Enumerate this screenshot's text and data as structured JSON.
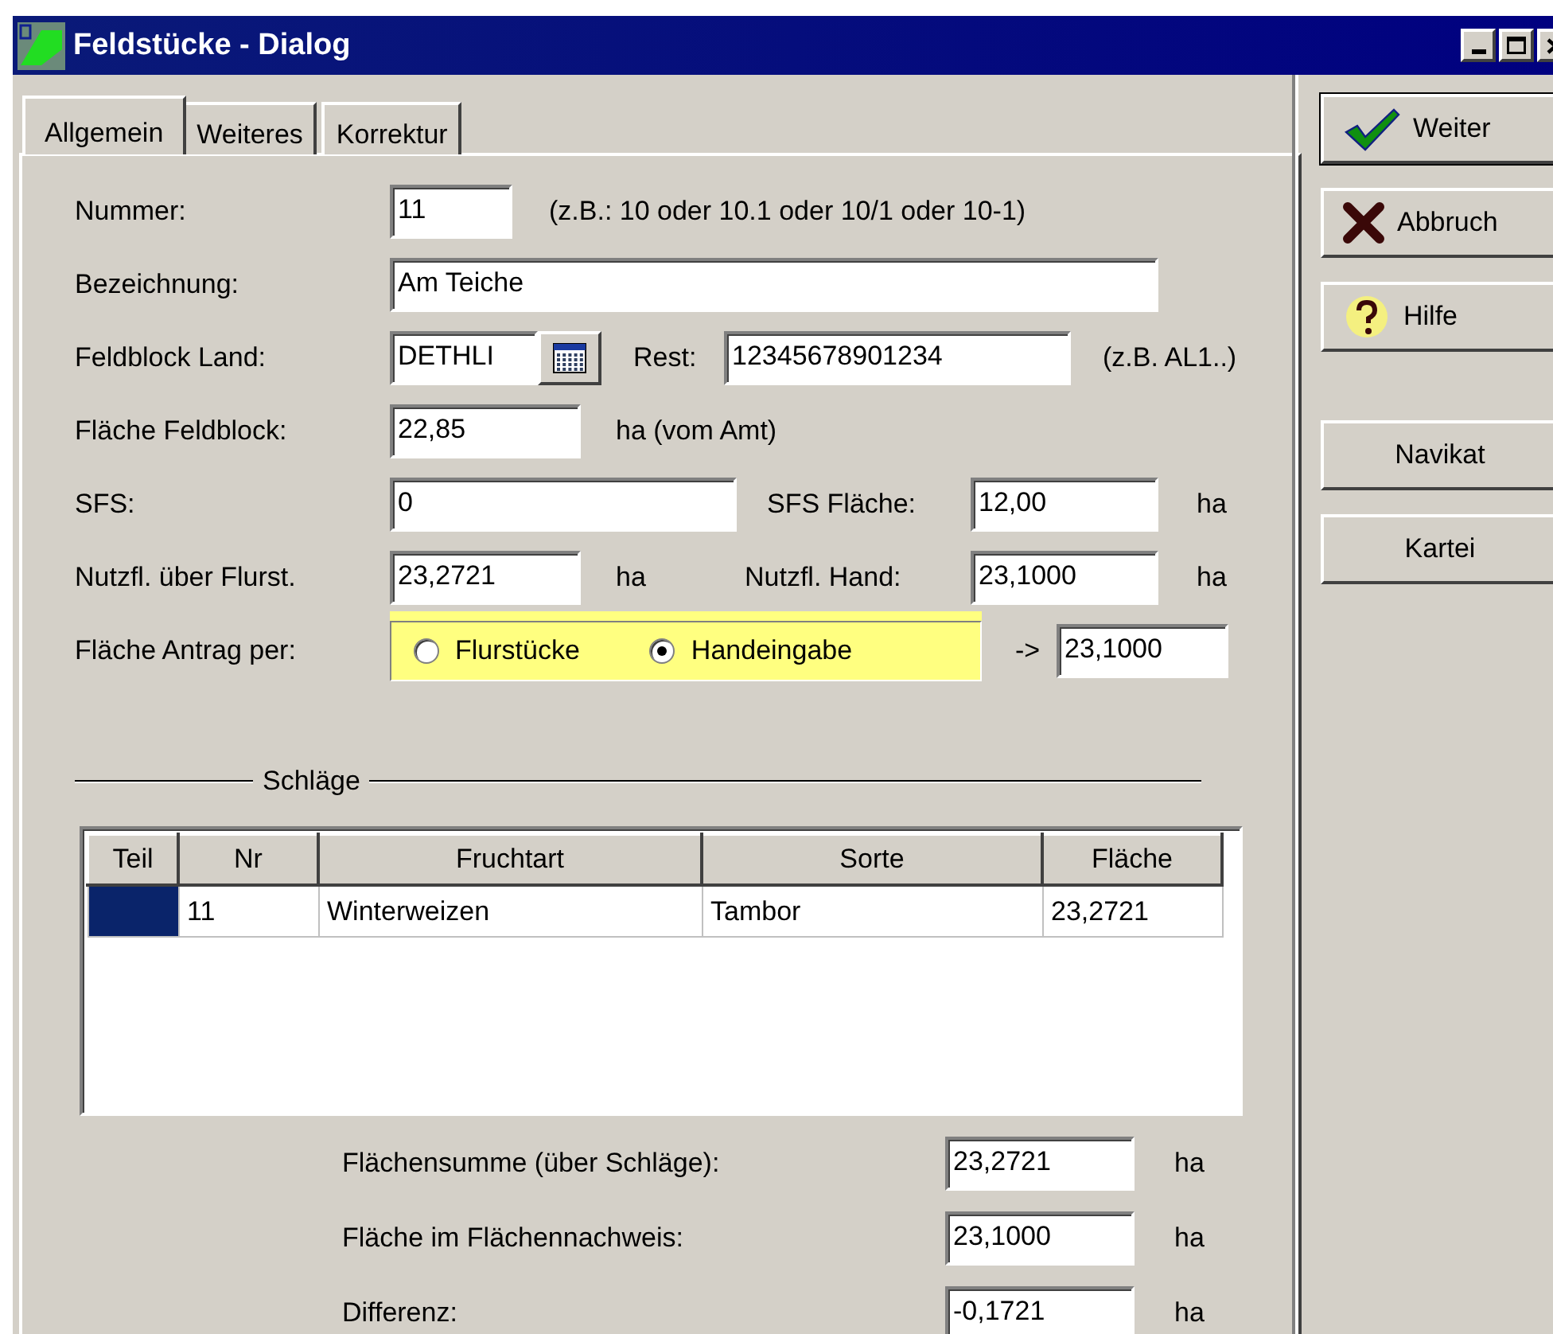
{
  "window": {
    "title": "Feldstücke - Dialog"
  },
  "tabs": [
    {
      "label": "Allgemein",
      "selected": true
    },
    {
      "label": "Weiteres",
      "selected": false
    },
    {
      "label": "Korrektur",
      "selected": false
    }
  ],
  "form": [
    {
      "items": [
        {
          "kind": "label",
          "text": "Nummer:"
        },
        {
          "kind": "field",
          "value": "11"
        },
        {
          "kind": "note",
          "text": "(z.B.: 10 oder 10.1 oder 10/1 oder 10-1)"
        }
      ]
    },
    {
      "items": [
        {
          "kind": "label",
          "text": "Bezeichnung:"
        },
        {
          "kind": "field",
          "value": "Am Teiche"
        }
      ]
    },
    {
      "items": [
        {
          "kind": "label",
          "text": "Feldblock Land:"
        },
        {
          "kind": "field",
          "value": "DETHLI"
        },
        {
          "kind": "calendar"
        },
        {
          "kind": "note",
          "text": "Rest:"
        },
        {
          "kind": "field",
          "value": "12345678901234"
        },
        {
          "kind": "note",
          "text": "(z.B. AL1..)"
        }
      ]
    },
    {
      "items": [
        {
          "kind": "label",
          "text": "Fläche Feldblock:"
        },
        {
          "kind": "field",
          "value": "22,85"
        },
        {
          "kind": "note",
          "text": "ha (vom Amt)"
        }
      ]
    },
    {
      "items": [
        {
          "kind": "label",
          "text": "SFS:"
        },
        {
          "kind": "field",
          "value": "0"
        },
        {
          "kind": "note",
          "text": "SFS Fläche:"
        },
        {
          "kind": "field",
          "value": "12,00"
        },
        {
          "kind": "note",
          "text": "ha"
        }
      ]
    },
    {
      "items": [
        {
          "kind": "label",
          "text": "Nutzfl. über Flurst."
        },
        {
          "kind": "field",
          "value": "23,2721"
        },
        {
          "kind": "note",
          "text": "ha"
        },
        {
          "kind": "note",
          "text": "Nutzfl. Hand:"
        },
        {
          "kind": "field",
          "value": "23,1000"
        },
        {
          "kind": "note",
          "text": "ha"
        }
      ]
    },
    {
      "items": [
        {
          "kind": "label",
          "text": "Fläche Antrag per:"
        },
        {
          "kind": "radios",
          "options": [
            {
              "label": "Flurstücke",
              "selected": false
            },
            {
              "label": "Handeingabe",
              "selected": true
            }
          ]
        },
        {
          "kind": "note",
          "text": "->"
        },
        {
          "kind": "field",
          "value": "23,1000"
        }
      ]
    }
  ],
  "section": {
    "title": "Schläge"
  },
  "table": {
    "columns": [
      "Teil",
      "Nr",
      "Fruchtart",
      "Sorte",
      "Fläche"
    ],
    "rows": [
      {
        "selected": true,
        "cells": [
          "",
          "11",
          "Winterweizen",
          "Tambor",
          "23,2721"
        ]
      }
    ]
  },
  "summary": [
    {
      "label": "Flächensumme (über Schläge):",
      "value": "23,2721",
      "unit": "ha"
    },
    {
      "label": "Fläche im Flächennachweis:",
      "value": "23,1000",
      "unit": "ha"
    },
    {
      "label": "Differenz:",
      "value": "-0,1721",
      "unit": "ha"
    }
  ],
  "buttons": [
    {
      "label": "Weiter",
      "kind": "ok",
      "default": true
    },
    {
      "label": "Abbruch",
      "kind": "cancel",
      "default": false
    },
    {
      "label": "Hilfe",
      "kind": "help",
      "default": false
    },
    {
      "label": "Navikat",
      "kind": "plain",
      "default": false
    },
    {
      "label": "Kartei",
      "kind": "plain",
      "default": false
    }
  ]
}
